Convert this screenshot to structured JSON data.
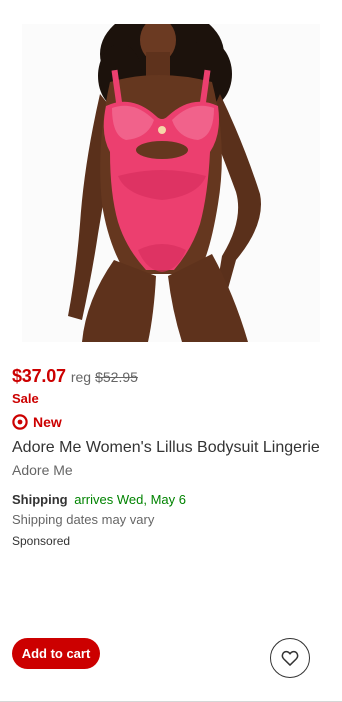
{
  "product": {
    "image_alt": "Adore Me Women's Lillus Bodysuit Lingerie",
    "price": "$37.07",
    "reg_label": "reg",
    "reg_price": "$52.95",
    "sale_label": "Sale",
    "new_label": "New",
    "title": "Adore Me Women's Lillus Bodysuit Lingerie",
    "brand": "Adore Me",
    "shipping_label": "Shipping",
    "shipping_date": "arrives Wed, May 6",
    "shipping_note": "Shipping dates may vary",
    "sponsored": "Sponsored"
  },
  "actions": {
    "add_to_cart_label": "Add to cart",
    "favorite_icon": "heart-icon"
  },
  "colors": {
    "accent": "#cc0000",
    "shipping_green": "#008300",
    "bodysuit_pink": "#ec3f6f"
  }
}
